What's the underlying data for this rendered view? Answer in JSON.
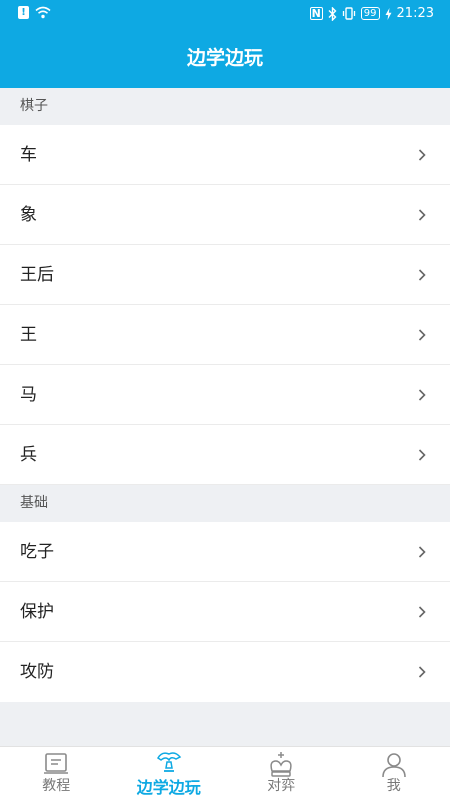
{
  "status_bar": {
    "time": "21:23",
    "battery": "99",
    "nfc": "N",
    "icons": [
      "warning-icon",
      "wifi-icon",
      "nfc-icon",
      "bluetooth-icon",
      "vibrate-icon",
      "battery-icon",
      "charging-icon"
    ]
  },
  "header": {
    "title": "边学边玩"
  },
  "sections": [
    {
      "title": "棋子",
      "items": [
        {
          "label": "车"
        },
        {
          "label": "象"
        },
        {
          "label": "王后"
        },
        {
          "label": "王"
        },
        {
          "label": "马"
        },
        {
          "label": "兵"
        }
      ]
    },
    {
      "title": "基础",
      "items": [
        {
          "label": "吃子"
        },
        {
          "label": "保护"
        },
        {
          "label": "攻防"
        }
      ]
    }
  ],
  "tabbar": {
    "tabs": [
      {
        "label": "教程",
        "icon": "tutorial-icon",
        "active": false
      },
      {
        "label": "边学边玩",
        "icon": "learn-play-icon",
        "active": true
      },
      {
        "label": "对弈",
        "icon": "chess-king-icon",
        "active": false
      },
      {
        "label": "我",
        "icon": "person-icon",
        "active": false
      }
    ]
  },
  "colors": {
    "accent": "#0ea9e3",
    "background": "#eef0f3"
  }
}
